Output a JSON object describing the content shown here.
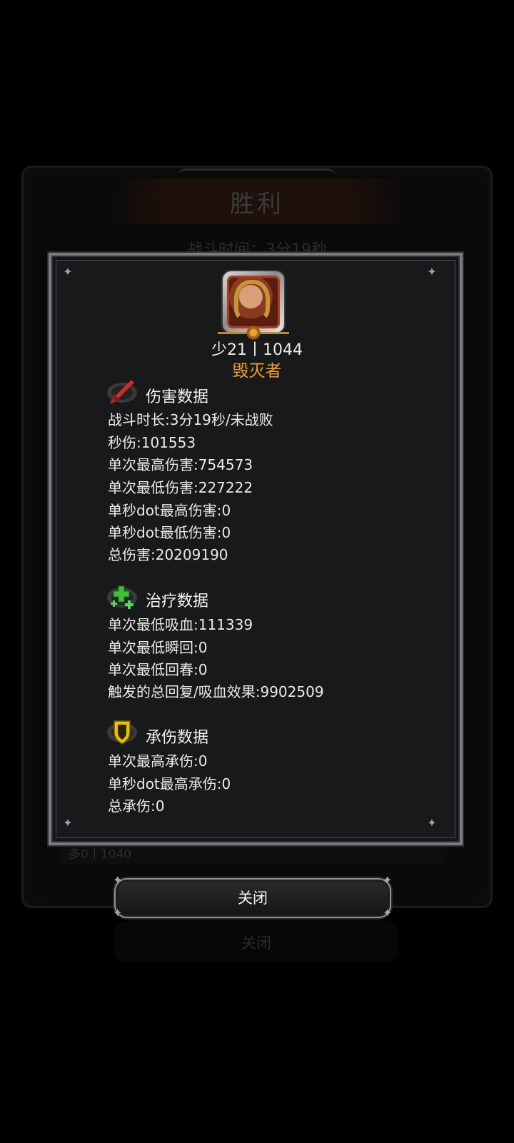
{
  "background": {
    "title": "胜利",
    "battle_time": "战斗时间：3分19秒",
    "bottom_row": "多0丨1040",
    "close_label": "关闭"
  },
  "player": {
    "line": "少21丨1044",
    "title": "毁灭者"
  },
  "sections": {
    "damage": {
      "title": "伤害数据",
      "icon": "red-sword-icon",
      "stats": [
        "战斗时长:3分19秒/未战败",
        "秒伤:101553",
        "单次最高伤害:754573",
        "单次最低伤害:227222",
        "单秒dot最高伤害:0",
        "单秒dot最低伤害:0",
        "总伤害:20209190"
      ]
    },
    "healing": {
      "title": "治疗数据",
      "icon": "green-cross-icon",
      "stats": [
        "单次最低吸血:111339",
        "单次最低瞬回:0",
        "单次最低回春:0",
        "触发的总回复/吸血效果:9902509"
      ]
    },
    "tanking": {
      "title": "承伤数据",
      "icon": "yellow-shield-icon",
      "stats": [
        "单次最高承伤:0",
        "单秒dot最高承伤:0",
        "总承伤:0"
      ]
    }
  },
  "close_button": {
    "label": "关闭"
  },
  "colors": {
    "player_title": "#f0a020",
    "panel_bg": "#18191b",
    "damage_icon": "#d42a2a",
    "healing_icon": "#3ec23e",
    "tanking_icon": "#e8c400"
  }
}
